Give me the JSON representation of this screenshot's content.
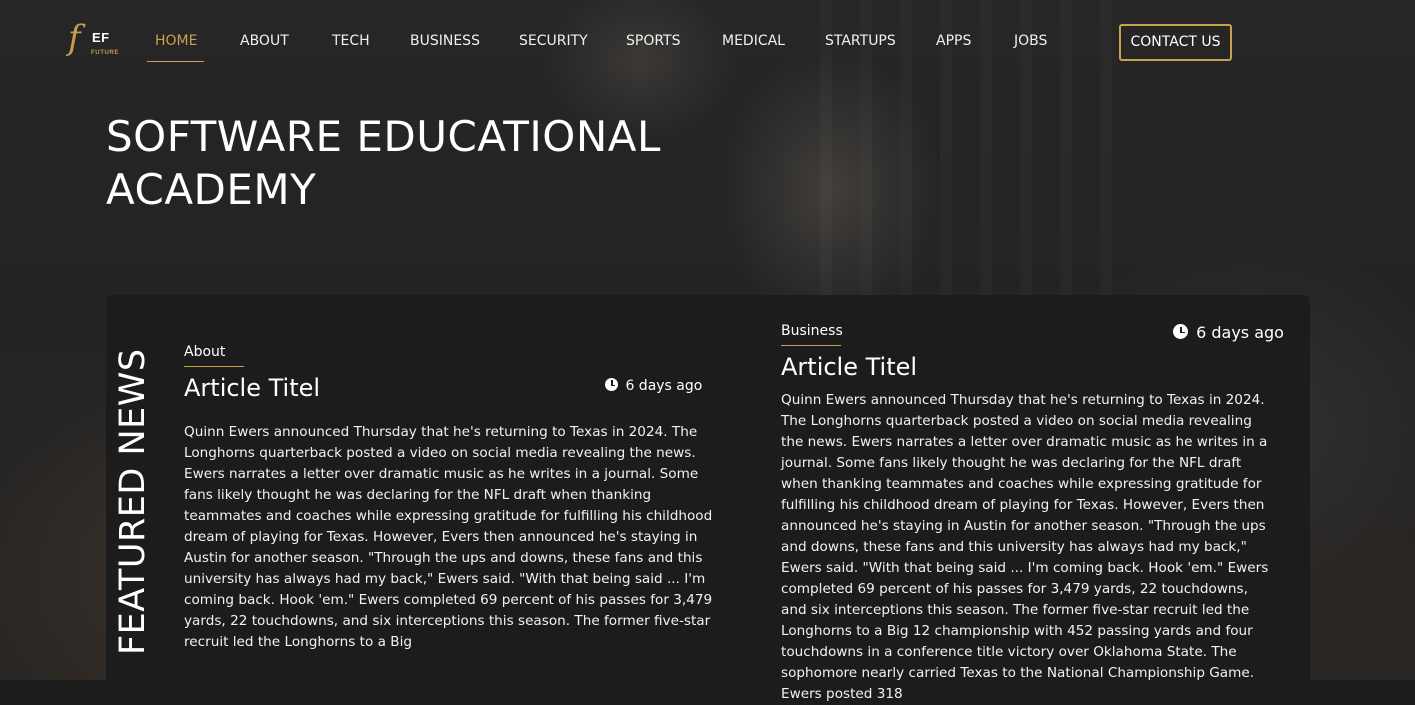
{
  "brand": {
    "mark": "f",
    "name": "EF",
    "tagline": "FUTURE"
  },
  "nav": {
    "items": [
      {
        "label": "HOME",
        "active": true
      },
      {
        "label": "ABOUT"
      },
      {
        "label": "TECH"
      },
      {
        "label": "BUSINESS"
      },
      {
        "label": "SECURITY"
      },
      {
        "label": "SPORTS"
      },
      {
        "label": "MEDICAL"
      },
      {
        "label": "STARTUPS"
      },
      {
        "label": "APPS"
      },
      {
        "label": "JOBS"
      }
    ],
    "contact_label": "CONTACT US"
  },
  "hero": {
    "title": "SOFTWARE EDUCATIONAL ACADEMY"
  },
  "featured": {
    "label": "FEATURED NEWS",
    "cards": [
      {
        "category": "About",
        "time": "6 days ago",
        "title": "Article Titel",
        "body": "Quinn Ewers announced Thursday that he's returning to Texas in 2024. The Longhorns quarterback posted a video on social media revealing the news. Ewers narrates a letter over dramatic music as he writes in a journal. Some fans likely thought he was declaring for the NFL draft when thanking teammates and coaches while expressing gratitude for fulfilling his childhood dream of playing for Texas. However, Evers then announced he's staying in Austin for another season. \"Through the ups and downs, these fans and this university has always had my back,\" Ewers said. \"With that being said ... I'm coming back. Hook 'em.\" Ewers completed 69 percent of his passes for 3,479 yards, 22 touchdowns, and six interceptions this season. The former five-star recruit led the Longhorns to a Big"
      },
      {
        "category": "Business",
        "time": "6 days ago",
        "title": "Article Titel",
        "body": "Quinn Ewers announced Thursday that he's returning to Texas in 2024. The Longhorns quarterback posted a video on social media revealing the news. Ewers narrates a letter over dramatic music as he writes in a journal. Some fans likely thought he was declaring for the NFL draft when thanking teammates and coaches while expressing gratitude for fulfilling his childhood dream of playing for Texas. However, Evers then announced he's staying in Austin for another season. \"Through the ups and downs, these fans and this university has always had my back,\" Ewers said. \"With that being said ... I'm coming back. Hook 'em.\" Ewers completed 69 percent of his passes for 3,479 yards, 22 touchdowns, and six interceptions this season. The former five-star recruit led the Longhorns to a Big 12 championship with 452 passing yards and four touchdowns in a conference title victory over Oklahoma State. The sophomore nearly carried Texas to the National Championship Game. Ewers posted 318"
      }
    ]
  },
  "colors": {
    "accent": "#c9a04e",
    "background": "#1c1c1c",
    "text": "#ffffff"
  },
  "icons": {
    "clock": "clock-icon",
    "logo": "ef-future-logo"
  }
}
